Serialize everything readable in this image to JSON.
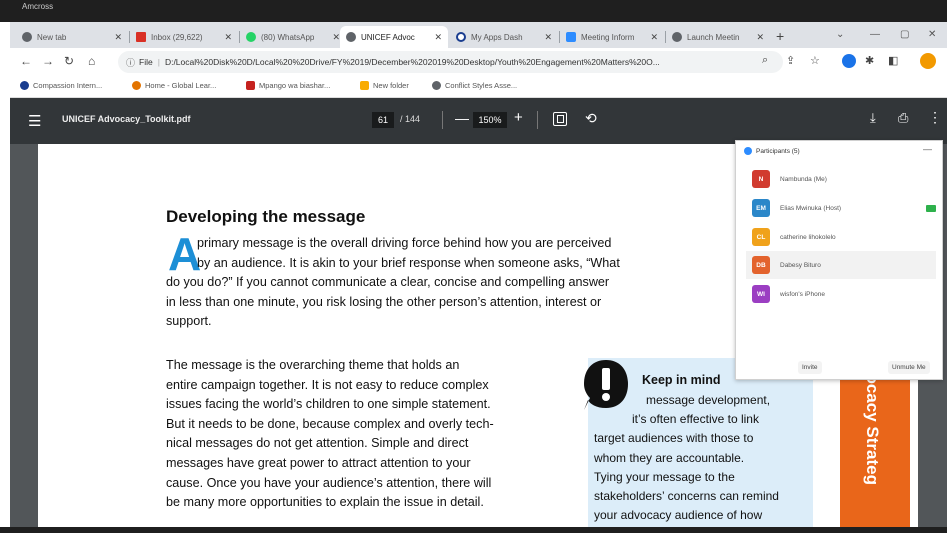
{
  "window": {
    "title_fragment": "Amcross"
  },
  "tabs": [
    {
      "label": "New tab",
      "icon": "chrome-icon",
      "color": "#5f6368",
      "active": false
    },
    {
      "label": "Inbox (29,622)",
      "icon": "gmail-icon",
      "color": "#d93025",
      "active": false
    },
    {
      "label": "(80) WhatsApp",
      "icon": "whatsapp-icon",
      "color": "#25d366",
      "active": false
    },
    {
      "label": "UNICEF Advoc",
      "icon": "chrome-icon",
      "color": "#5f6368",
      "active": true
    },
    {
      "label": "My Apps Dash",
      "icon": "okta-icon",
      "color": "#1a3d8f",
      "active": false
    },
    {
      "label": "Meeting Inform",
      "icon": "zoom-icon",
      "color": "#2d8cff",
      "active": false
    },
    {
      "label": "Launch Meetin",
      "icon": "chrome-icon",
      "color": "#5f6368",
      "active": false
    }
  ],
  "address": {
    "scheme": "File",
    "url": "D:/Local%20Disk%20D/Local%20%20Drive/FY%2019/December%202019%20Desktop/Youth%20Engagement%20Matters%20O..."
  },
  "bookmarks": [
    {
      "label": "Compassion Intern...",
      "color": "#1a3d8f"
    },
    {
      "label": "Home - Global Lear...",
      "color": "#e37400"
    },
    {
      "label": "Mpango wa biashar...",
      "color": "#c5221f"
    },
    {
      "label": "New folder",
      "color": "#f9ab00"
    },
    {
      "label": "Conflict Styles Asse...",
      "color": "#5f6368"
    }
  ],
  "pdf": {
    "filename": "UNICEF Advocacy_Toolkit.pdf",
    "page_current": "61",
    "page_total": "/ 144",
    "zoom": "150%"
  },
  "document": {
    "heading": "Developing the message",
    "dropcap": "A",
    "intro_lines": [
      "primary message is the overall driving force behind how you are perceived",
      "by an audience. It is akin to your brief response when someone asks, “What",
      "do you do?”  If you cannot communicate a clear, concise and compelling answer",
      "in less than one minute, you risk losing the other person’s attention, interest or",
      "support."
    ],
    "body_lines": [
      "The message is the overarching theme that holds an",
      "entire campaign together. It is not easy to reduce complex",
      "issues facing the world’s children to one simple statement.",
      "But it needs to be done, because complex and overly tech-",
      "nical messages do not get attention. Simple and direct",
      "messages have great power to attract attention to your",
      "cause. Once you have your audience’s attention, there will",
      "be many more opportunities to explain the issue in detail."
    ],
    "callout": {
      "title": "Keep in mind",
      "lines": [
        "message development,",
        "it’s often effective to link",
        "target audiences with those to",
        "whom they are accountable.",
        "Tying your message to the",
        "stakeholders’ concerns can remind",
        "your advocacy audience of how"
      ]
    },
    "side_band": "vocacy Strateg",
    "accent_blue": "#1d8fd6",
    "accent_orange": "#e9661a"
  },
  "participants": {
    "header": "Participants (5)",
    "list": [
      {
        "initials": "N",
        "name": "Nambunda (Me)",
        "color": "#d13b2f",
        "badge": false
      },
      {
        "initials": "EM",
        "name": "Elias Mwinuka (Host)",
        "color": "#2b87c9",
        "badge": true
      },
      {
        "initials": "CL",
        "name": "catherine lihokolelo",
        "color": "#f0a21b",
        "badge": false
      },
      {
        "initials": "DB",
        "name": "Dabesy Bituro",
        "color": "#e3632d",
        "badge": false
      },
      {
        "initials": "WI",
        "name": "wisfon's iPhone",
        "color": "#9b3ec2",
        "badge": false
      }
    ],
    "invite_label": "Invite",
    "unmute_label": "Unmute Me"
  }
}
